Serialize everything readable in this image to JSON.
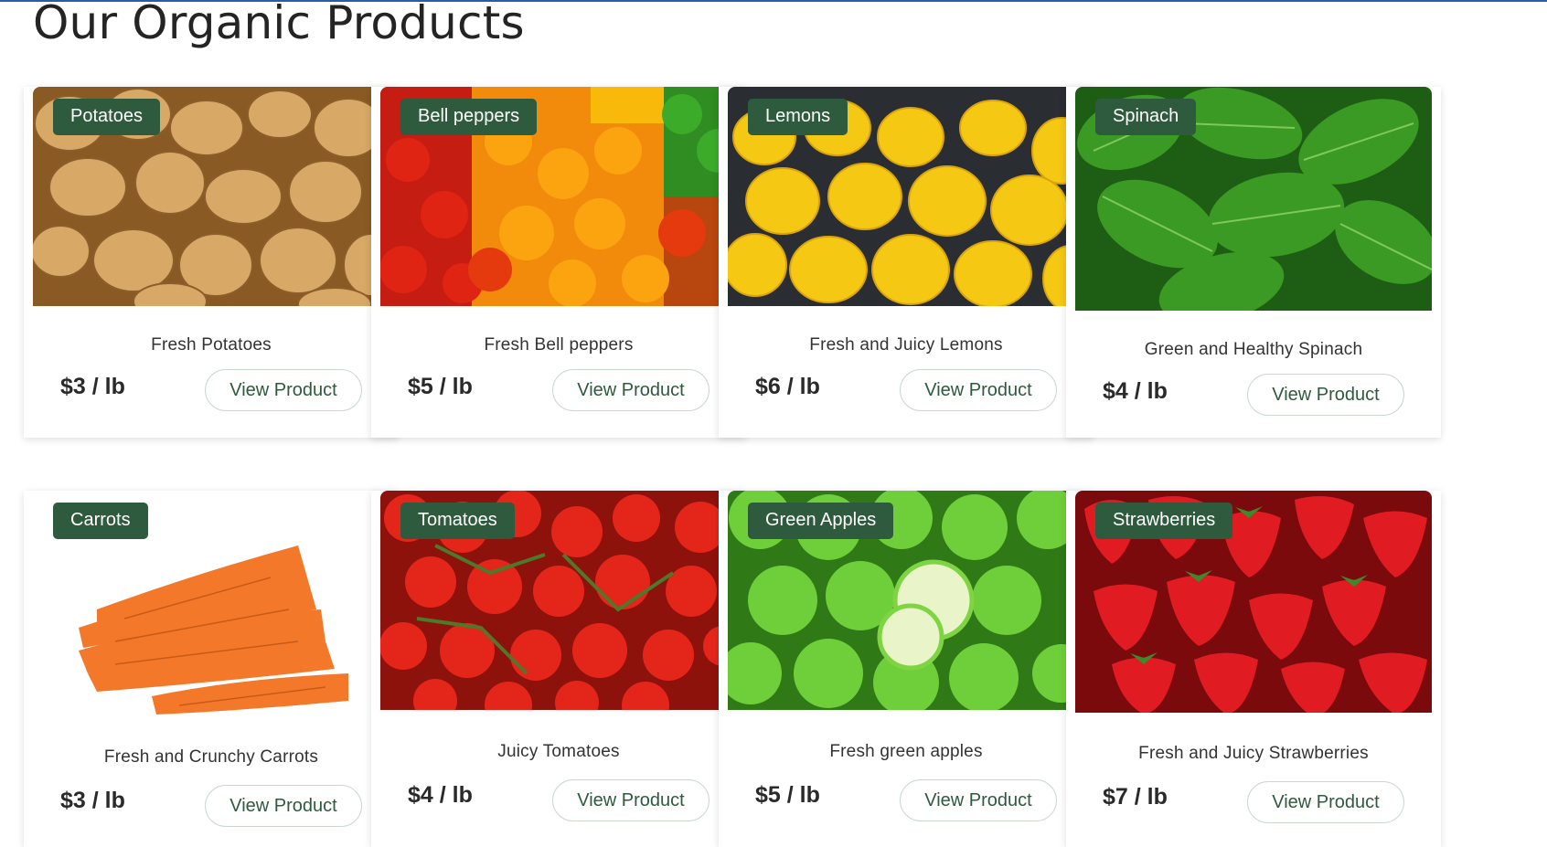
{
  "header": {
    "title": "Our Organic Products"
  },
  "products": [
    {
      "name": "Potatoes",
      "description": "Fresh Potatoes",
      "price": "$3 / lb",
      "button_label": "View Product",
      "image_icon": "potatoes-image"
    },
    {
      "name": "Bell peppers",
      "description": "Fresh Bell peppers",
      "price": "$5 / lb",
      "button_label": "View Product",
      "image_icon": "bell-peppers-image"
    },
    {
      "name": "Lemons",
      "description": "Fresh and Juicy Lemons",
      "price": "$6 / lb",
      "button_label": "View Product",
      "image_icon": "lemons-image"
    },
    {
      "name": "Spinach",
      "description": "Green and Healthy Spinach",
      "price": "$4 / lb",
      "button_label": "View Product",
      "image_icon": "spinach-image"
    },
    {
      "name": "Carrots",
      "description": "Fresh and Crunchy Carrots",
      "price": "$3 / lb",
      "button_label": "View Product",
      "image_icon": "carrots-image"
    },
    {
      "name": "Tomatoes",
      "description": "Juicy Tomatoes",
      "price": "$4 / lb",
      "button_label": "View Product",
      "image_icon": "tomatoes-image"
    },
    {
      "name": "Green Apples",
      "description": "Fresh green apples",
      "price": "$5 / lb",
      "button_label": "View Product",
      "image_icon": "green-apples-image"
    },
    {
      "name": "Strawberries",
      "description": "Fresh and Juicy Strawberries",
      "price": "$7 / lb",
      "button_label": "View Product",
      "image_icon": "strawberries-image"
    }
  ],
  "colors": {
    "tag_bg": "#2e5a3d",
    "accent": "#2e5a3d",
    "top_line": "#2a5da8"
  }
}
